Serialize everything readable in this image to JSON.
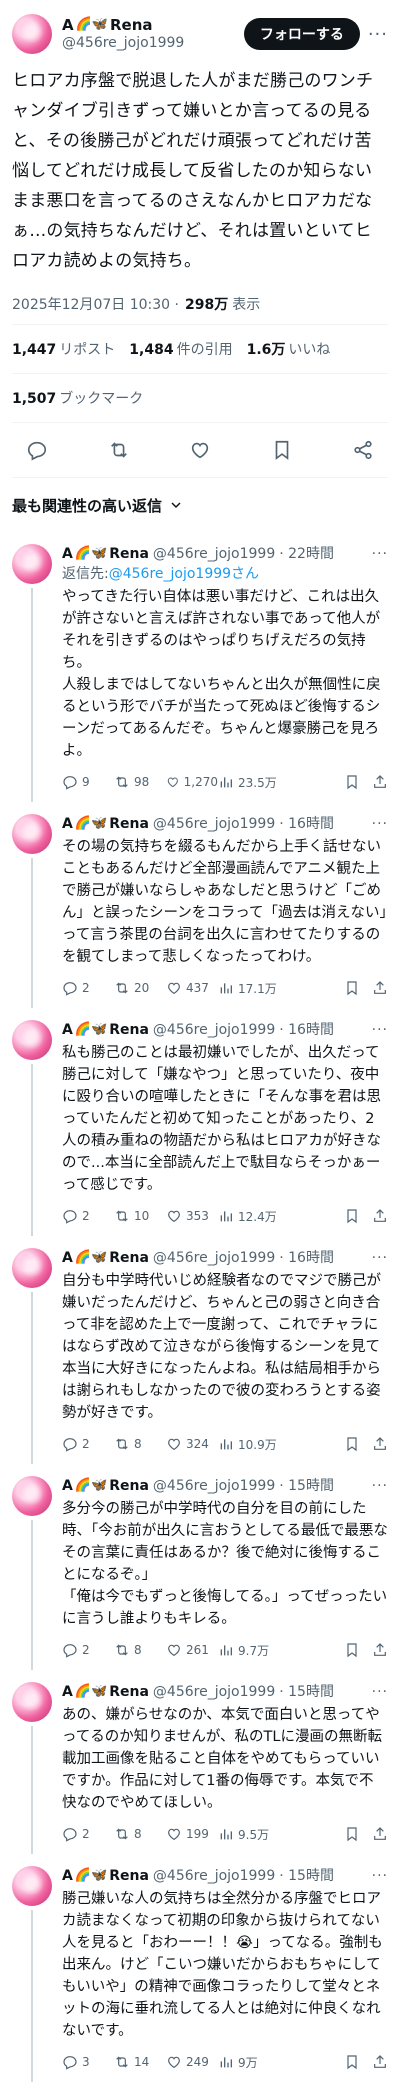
{
  "tweet": {
    "display_name": "A",
    "name_suffix": "Rena",
    "name_emojis": "🌈🦋",
    "handle": "@456re_jojo1999",
    "follow_label": "フォローする",
    "more_label": "···",
    "text": "ヒロアカ序盤で脱退した人がまだ勝己のワンチャンダイブ引きずって嫌いとか言ってるの見ると、その後勝己がどれだけ頑張ってどれだけ苦悩してどれだけ成長して反省したのか知らないまま悪口を言ってるのさえなんかヒロアカだなぁ…の気持ちなんだけど、それは置いといてヒロアカ読めよの気持ち。",
    "timestamp": "2025年12月07日 10:30 ·",
    "views_count": "298万",
    "views_label": "表示",
    "reposts_count": "1,447",
    "reposts_label": "リポスト",
    "quotes_count": "1,484",
    "quotes_label": "件の引用",
    "likes_count": "1.6万",
    "likes_label": "いいね",
    "bookmarks_count": "1,507",
    "bookmarks_label": "ブックマーク"
  },
  "sort_label": "最も関連性の高い返信",
  "replies": [
    {
      "name": "A",
      "suffix": "Rena",
      "emojis": "🌈🦋",
      "handle": "@456re_jojo1999",
      "time": "· 22時間",
      "replying_prefix": "返信先:",
      "replying_to": "@456re_jojo1999さん",
      "text": "やってきた行い自体は悪い事だけど、これは出久が許さないと言えば許されない事であって他人がそれを引きずるのはやっぱりちげえだろの気持ち。\n人殺しまではしてないちゃんと出久が無個性に戻るという形でバチが当たって死ぬほど後悔するシーンだってあるんだぞ。ちゃんと爆豪勝己を見ろよ。",
      "replies": "9",
      "reposts": "98",
      "likes": "1,270",
      "views": "23.5万"
    },
    {
      "name": "A",
      "suffix": "Rena",
      "emojis": "🌈🦋",
      "handle": "@456re_jojo1999",
      "time": "· 16時間",
      "text": "その場の気持ちを綴るもんだから上手く話せないこともあるんだけど全部漫画読んでアニメ観た上で勝己が嫌いならしゃあなしだと思うけど「ごめん」と誤ったシーンをコラって「過去は消えない」って言う茶毘の台詞を出久に言わせてたりするのを観てしまって悲しくなったってわけ。",
      "replies": "2",
      "reposts": "20",
      "likes": "437",
      "views": "17.1万"
    },
    {
      "name": "A",
      "suffix": "Rena",
      "emojis": "🌈🦋",
      "handle": "@456re_jojo1999",
      "time": "· 16時間",
      "text": "私も勝己のことは最初嫌いでしたが、出久だって勝己に対して「嫌なやつ」と思っていたり、夜中に殴り合いの喧嘩したときに「そんな事を君は思っていたんだと初めて知ったことがあったり、2人の積み重ねの物語だから私はヒロアカが好きなので...本当に全部読んだ上で駄目ならそっかぁーって感じです。",
      "replies": "2",
      "reposts": "10",
      "likes": "353",
      "views": "12.4万"
    },
    {
      "name": "A",
      "suffix": "Rena",
      "emojis": "🌈🦋",
      "handle": "@456re_jojo1999",
      "time": "· 16時間",
      "text": "自分も中学時代いじめ経験者なのでマジで勝己が嫌いだったんだけど、ちゃんと己の弱さと向き合って非を認めた上で一度謝って、これでチャラにはならず改めて泣きながら後悔するシーンを見て本当に大好きになったんよね。私は結局相手からは謝られもしなかったので彼の変わろうとする姿勢が好きです。",
      "replies": "2",
      "reposts": "8",
      "likes": "324",
      "views": "10.9万"
    },
    {
      "name": "A",
      "suffix": "Rena",
      "emojis": "🌈🦋",
      "handle": "@456re_jojo1999",
      "time": "· 15時間",
      "text": "多分今の勝己が中学時代の自分を目の前にした時、「今お前が出久に言おうとしてる最低で最悪なその言葉に責任はあるか？後で絶対に後悔することになるぞ。」\n「俺は今でもずっと後悔してる。」ってぜっったいに言うし誰よりもキレる。",
      "replies": "2",
      "reposts": "8",
      "likes": "261",
      "views": "9.7万"
    },
    {
      "name": "A",
      "suffix": "Rena",
      "emojis": "🌈🦋",
      "handle": "@456re_jojo1999",
      "time": "· 15時間",
      "text": "あの、嫌がらせなのか、本気で面白いと思ってやってるのか知りませんが、私のTLに漫画の無断転載加工画像を貼ること自体をやめてもらっていいですか。作品に対して1番の侮辱です。本気で不快なのでやめてほしい。",
      "replies": "2",
      "reposts": "8",
      "likes": "199",
      "views": "9.5万"
    },
    {
      "name": "A",
      "suffix": "Rena",
      "emojis": "🌈🦋",
      "handle": "@456re_jojo1999",
      "time": "· 15時間",
      "text": "勝己嫌いな人の気持ちは全然分かる序盤でヒロアカ読まなくなって初期の印象から抜けられてない人を見ると「おわーー！！😭」ってなる。強制も出来ん。けど「こいつ嫌いだからおもちゃにしてもいいや」の精神で画像コラったりして堂々とネットの海に垂れ流してる人とは絶対に仲良くなれないです。",
      "replies": "3",
      "reposts": "14",
      "likes": "249",
      "views": "9万"
    }
  ]
}
